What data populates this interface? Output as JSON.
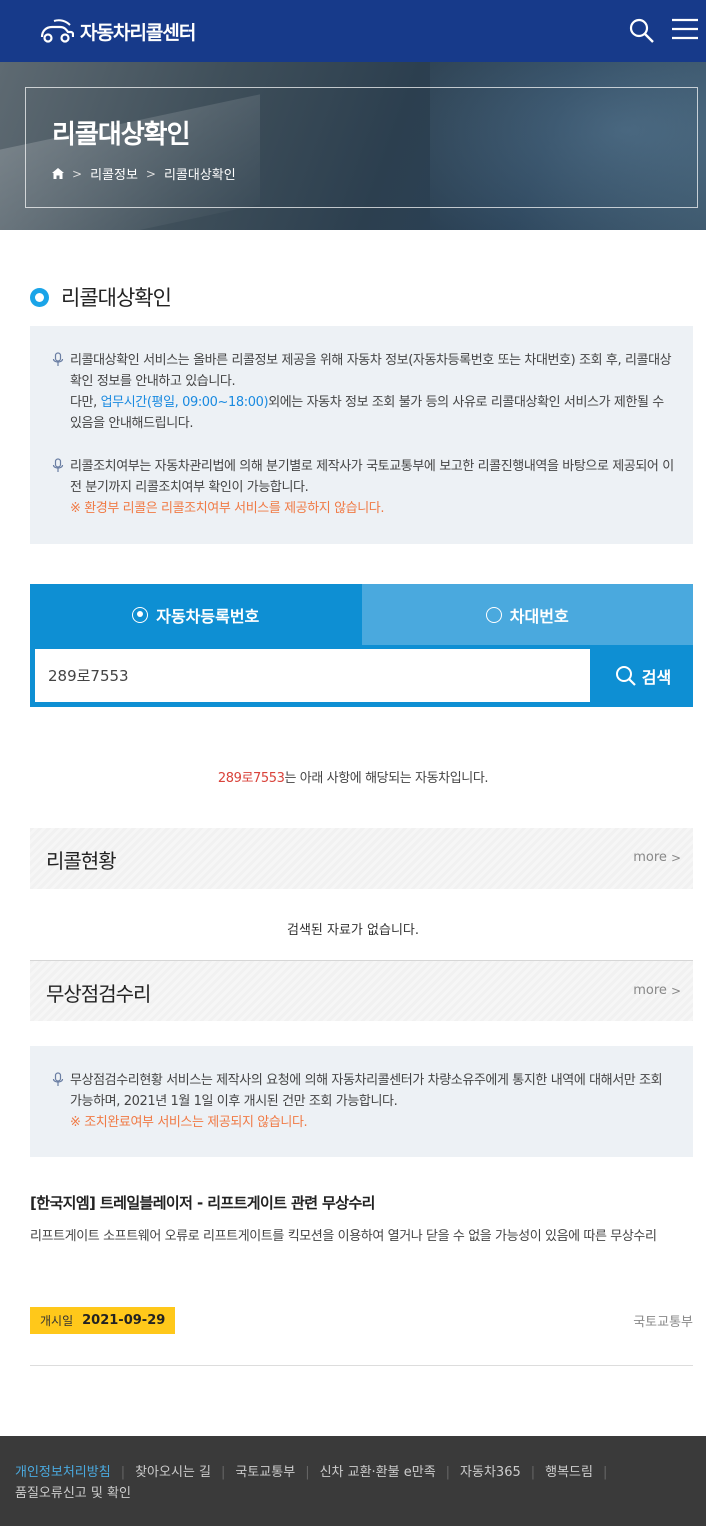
{
  "header": {
    "logo_text": "자동차리콜센터",
    "search_icon": "search-icon",
    "menu_icon": "hamburger-menu-icon"
  },
  "hero": {
    "title": "리콜대상확인",
    "breadcrumb": [
      "리콜정보",
      "리콜대상확인"
    ]
  },
  "section": {
    "title": "리콜대상확인"
  },
  "notice1": {
    "p1_text": "리콜대상확인 서비스는 올바른 리콜정보 제공을 위해 자동차 정보(자동차등록번호 또는 차대번호) 조회 후, 리콜대상확인 정보를 안내하고 있습니다.",
    "p1b_prefix": "다만, ",
    "p1b_hours": "업무시간(평일, 09:00~18:00)",
    "p1b_suffix": "외에는 자동차 정보 조회 불가 등의 사유로 리콜대상확인 서비스가 제한될 수 있음을 안내해드립니다.",
    "p2_text": "리콜조치여부는 자동차관리법에 의해 분기별로 제작사가 국토교통부에 보고한 리콜진행내역을 바탕으로 제공되어 이전 분기까지 리콜조치여부 확인이 가능합니다.",
    "p2_warning": "※ 환경부 리콜은 리콜조치여부 서비스를 제공하지 않습니다."
  },
  "search": {
    "tab1_label": "자동차등록번호",
    "tab2_label": "차대번호",
    "input_value": "289로7553",
    "button_label": "검색"
  },
  "result": {
    "plate": "289로7553",
    "message": "는 아래 사항에 해당되는 자동차입니다."
  },
  "recall_status": {
    "title": "리콜현황",
    "more_label": "more",
    "empty_text": "검색된 자료가 없습니다."
  },
  "free_repair": {
    "title": "무상점검수리",
    "more_label": "more",
    "notice_text": "무상점검수리현황 서비스는 제작사의 요청에 의해 자동차리콜센터가 차량소유주에게 통지한 내역에 대해서만 조회 가능하며, 2021년 1월 1일 이후 개시된 건만 조회 가능합니다.",
    "notice_warning": "※ 조치완료여부 서비스는 제공되지 않습니다.",
    "item": {
      "title": "[한국지엠] 트레일블레이저 - 리프트게이트 관련 무상수리",
      "desc": "리프트게이트 소프트웨어 오류로 리프트게이트를 킥모션을 이용하여 열거나 닫을 수 없을 가능성이 있음에 따른 무상수리",
      "date_label": "개시일",
      "date_value": "2021-09-29",
      "source": "국토교통부"
    }
  },
  "footer": {
    "links": [
      "개인정보처리방침",
      "찾아오시는 길",
      "국토교통부",
      "신차 교환·환불 e만족",
      "자동차365",
      "행복드림",
      "품질오류신고 및 확인"
    ]
  },
  "colors": {
    "header_bg": "#173a8a",
    "tab_active": "#0e8fd3",
    "tab_inactive": "#4aa9de",
    "warning": "#f07a45",
    "date_badge": "#ffc81a",
    "footer_bg": "#3a3a3a"
  }
}
